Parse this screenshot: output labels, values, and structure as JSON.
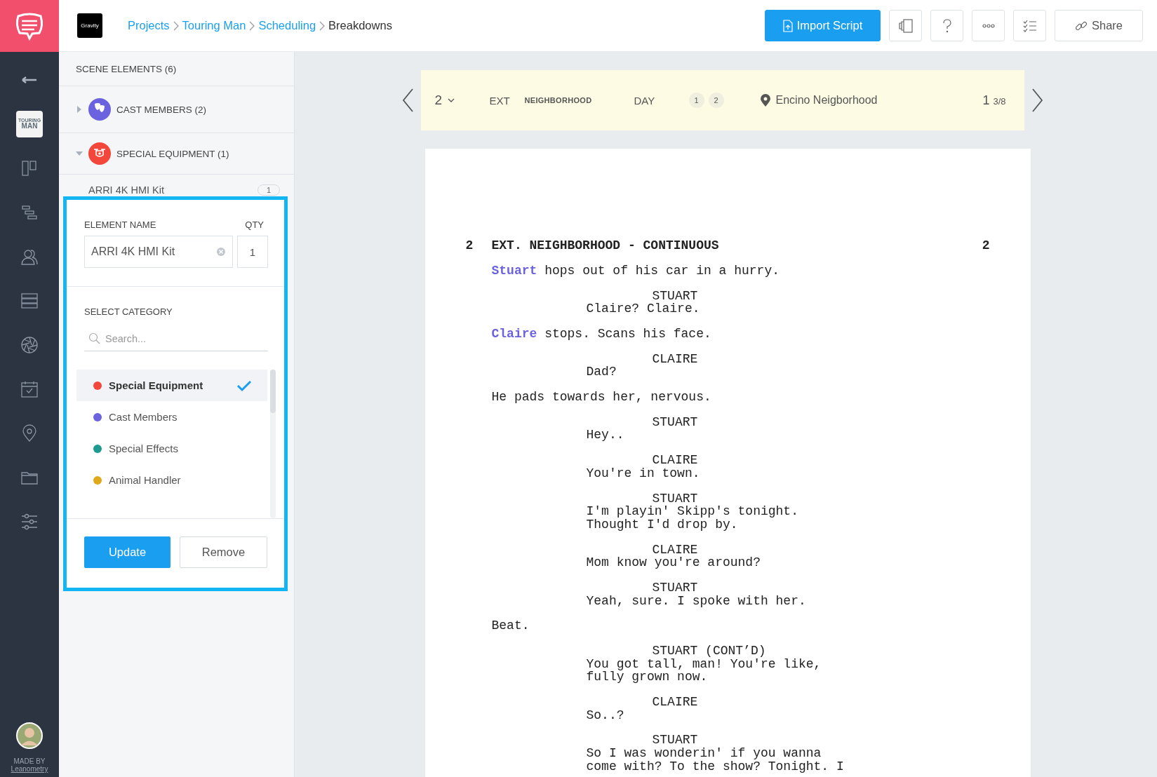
{
  "brand": {
    "footer_label": "MADE BY",
    "footer_link": "Leanometry"
  },
  "project_logo": {
    "lines": [
      "TOURING",
      "MAN"
    ]
  },
  "header": {
    "company_logo": "Gravity",
    "breadcrumb": [
      {
        "label": "Projects",
        "current": false
      },
      {
        "label": "Touring Man",
        "current": false
      },
      {
        "label": "Scheduling",
        "current": false
      },
      {
        "label": "Breakdowns",
        "current": true
      }
    ],
    "import_button": "Import Script",
    "share_button": "Share"
  },
  "panel": {
    "title": "SCENE ELEMENTS (6)",
    "groups": [
      {
        "label": "CAST MEMBERS (2)",
        "kind": "cast",
        "color": "#6a62de",
        "expanded": false
      },
      {
        "label": "SPECIAL EQUIPMENT (1)",
        "kind": "equipment",
        "color": "#f2473a",
        "expanded": true,
        "items": [
          {
            "name": "ARRI 4K HMI Kit",
            "qty": "1"
          }
        ]
      }
    ]
  },
  "editor": {
    "name_label": "ELEMENT NAME",
    "qty_label": "QTY",
    "name_value": "ARRI 4K HMI Kit",
    "qty_value": "1",
    "category_label": "SELECT CATEGORY",
    "search": {
      "placeholder": "Search..."
    },
    "categories": [
      {
        "label": "Special Equipment",
        "color": "#f2473a",
        "selected": true
      },
      {
        "label": "Cast Members",
        "color": "#6a62de",
        "selected": false
      },
      {
        "label": "Special Effects",
        "color": "#1e9a8f",
        "selected": false
      },
      {
        "label": "Animal Handler",
        "color": "#e0a91c",
        "selected": false
      }
    ],
    "buttons": [
      {
        "label": "Update",
        "kind": "primary"
      },
      {
        "label": "Remove",
        "kind": "secondary"
      }
    ]
  },
  "scene": {
    "number": "2",
    "int_ext": "EXT",
    "location": "NEIGHBORHOOD",
    "time": "DAY",
    "cast": [
      "1",
      "2"
    ],
    "set": "Encino Neigborhood",
    "pages": "1",
    "pages_fraction": "3/8"
  },
  "script": {
    "blocks": [
      {
        "kind": "heading",
        "number": "2",
        "text": "EXT. NEIGHBORHOOD - CONTINUOUS",
        "number_end": "2"
      },
      {
        "kind": "action",
        "tag": "Stuart",
        "text": "hops out of his car in a hurry."
      },
      {
        "kind": "character",
        "text": "STUART"
      },
      {
        "kind": "dialogue",
        "lines": [
          "Claire? Claire."
        ]
      },
      {
        "kind": "action",
        "tag": "Claire",
        "text": "stops. Scans his face."
      },
      {
        "kind": "character",
        "text": "CLAIRE"
      },
      {
        "kind": "dialogue",
        "lines": [
          "Dad?"
        ]
      },
      {
        "kind": "action",
        "text": "He pads towards her, nervous."
      },
      {
        "kind": "character",
        "text": "STUART"
      },
      {
        "kind": "dialogue",
        "lines": [
          "Hey.."
        ]
      },
      {
        "kind": "character",
        "text": "CLAIRE"
      },
      {
        "kind": "dialogue",
        "lines": [
          "You're in town."
        ]
      },
      {
        "kind": "character",
        "text": "STUART"
      },
      {
        "kind": "dialogue",
        "lines": [
          "I'm playin' Skipp's tonight.",
          "Thought I'd drop by."
        ]
      },
      {
        "kind": "character",
        "text": "CLAIRE"
      },
      {
        "kind": "dialogue",
        "lines": [
          "Mom know you're around?"
        ]
      },
      {
        "kind": "character",
        "text": "STUART"
      },
      {
        "kind": "dialogue",
        "lines": [
          "Yeah, sure. I spoke with her."
        ]
      },
      {
        "kind": "action",
        "text": "Beat."
      },
      {
        "kind": "character",
        "text": "STUART (CONT’D)"
      },
      {
        "kind": "dialogue",
        "lines": [
          "You got tall, man! You're like,",
          "fully grown now."
        ]
      },
      {
        "kind": "character",
        "text": "CLAIRE"
      },
      {
        "kind": "dialogue",
        "lines": [
          "So..?"
        ]
      },
      {
        "kind": "character",
        "text": "STUART"
      },
      {
        "kind": "dialogue",
        "lines": [
          "So I was wonderin' if you wanna",
          "come with? To the show? Tonight. I"
        ]
      }
    ]
  }
}
